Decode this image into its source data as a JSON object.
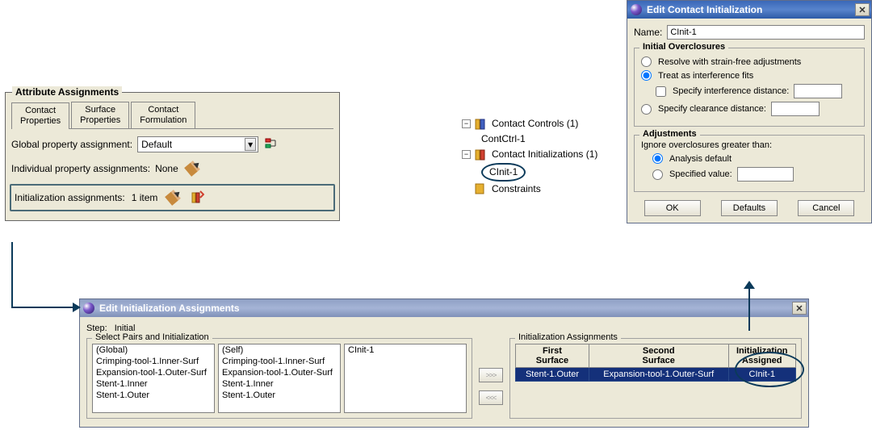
{
  "attr": {
    "group_title": "Attribute Assignments",
    "tabs": [
      "Contact\nProperties",
      "Surface\nProperties",
      "Contact\nFormulation"
    ],
    "global_label": "Global property assignment:",
    "global_value": "Default",
    "individual_label": "Individual property assignments:",
    "individual_value": "None",
    "init_label": "Initialization assignments:",
    "init_value": "1 item"
  },
  "tree": {
    "controls_label": "Contact Controls (1)",
    "controls_child": "ContCtrl-1",
    "inits_label": "Contact Initializations (1)",
    "inits_child": "CInit-1",
    "constraints_label": "Constraints"
  },
  "dlg": {
    "title": "Edit Contact Initialization",
    "name_label": "Name:",
    "name_value": "CInit-1",
    "overclosures_title": "Initial Overclosures",
    "r1": "Resolve with strain-free adjustments",
    "r2": "Treat as interference fits",
    "chk": "Specify interference distance:",
    "r3": "Specify clearance distance:",
    "adjust_title": "Adjustments",
    "adjust_label": "Ignore overclosures greater than:",
    "a1": "Analysis default",
    "a2": "Specified value:",
    "ok": "OK",
    "defaults": "Defaults",
    "cancel": "Cancel"
  },
  "ia": {
    "title": "Edit Initialization Assignments",
    "step_label": "Step:",
    "step_value": "Initial",
    "sel_title": "Select Pairs and Initialization",
    "list1": [
      "(Global)",
      "Crimping-tool-1.Inner-Surf",
      "Expansion-tool-1.Outer-Surf",
      "Stent-1.Inner",
      "Stent-1.Outer"
    ],
    "list2": [
      "(Self)",
      "Crimping-tool-1.Inner-Surf",
      "Expansion-tool-1.Outer-Surf",
      "Stent-1.Inner",
      "Stent-1.Outer"
    ],
    "list3": [
      "CInit-1"
    ],
    "assign_title": "Initialization Assignments",
    "th1": "First\nSurface",
    "th2": "Second\nSurface",
    "th3": "Initialization\nAssigned",
    "row": [
      "Stent-1.Outer",
      "Expansion-tool-1.Outer-Surf",
      "CInit-1"
    ]
  }
}
